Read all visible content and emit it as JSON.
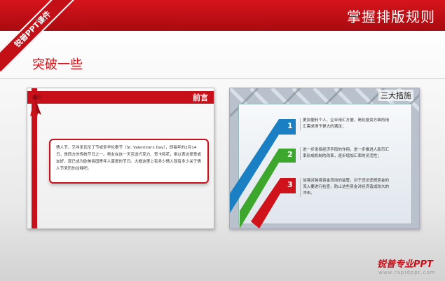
{
  "header": {
    "title": "掌握排版规则"
  },
  "ribbon": {
    "label": "锐普PPT课件"
  },
  "section": {
    "title": "突破一些"
  },
  "left_card": {
    "title": "前言",
    "body": "情人节，又叫圣瓦伦丁节或圣华伦泰节（St. Valentine's Day），即每年的2月14日，是西方的传统节日之一。男女在这一天互送巧克力、贺卡和花，用以表达爱意或友好，现已成为欧美各国青年人喜爱的节日。大概这里上有多少情人就有多少关于情人节来历的诠释吧。"
  },
  "right_card": {
    "title": "三大措施",
    "steps": [
      {
        "num": "1",
        "text": "更加便利个人、企业用汇方便，简化投资方面的用汇需求得予更大的满足；"
      },
      {
        "num": "2",
        "text": "进一步发挥经济手段的作用，进一步推进人民币汇率形成机制的改革，逐步增加汇率的灵活性；"
      },
      {
        "num": "3",
        "text": "加强对跨境资金流动的监管，对于违法违规资金的流入要进行检查，防止这些资金对经济造成较大的冲击。"
      }
    ]
  },
  "footer": {
    "logo": "锐普专业PPT",
    "url": "www.rapidppt.com"
  },
  "colors": {
    "accent": "#c8101a",
    "blue": "#1b7fc4",
    "green": "#3da62c",
    "red": "#d0121b"
  }
}
